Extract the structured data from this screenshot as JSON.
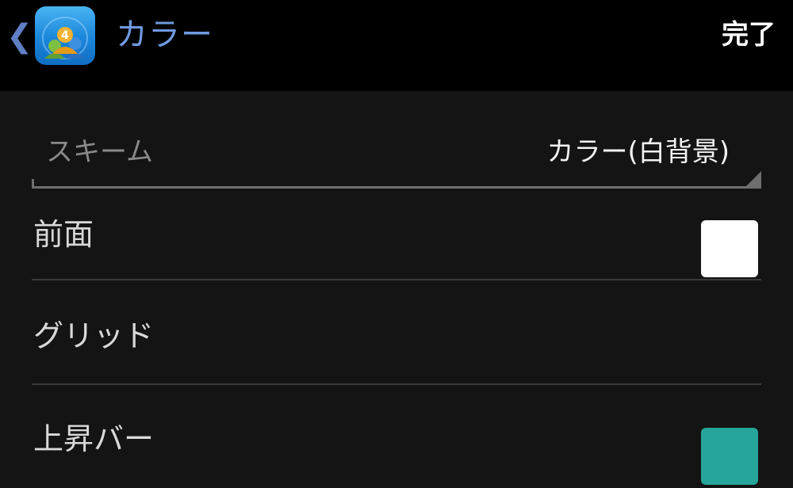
{
  "header": {
    "back_glyph": "❮",
    "app_icon": "metatrader-4-icon",
    "title": "カラー",
    "done_label": "完了",
    "title_color": "#6f9ae0"
  },
  "scheme": {
    "label": "スキーム",
    "value": "カラー(白背景)"
  },
  "rows": [
    {
      "label": "前面",
      "swatch_color": "#ffffff"
    },
    {
      "label": "グリッド"
    },
    {
      "label": "上昇バー",
      "swatch_color": "#26a69a"
    }
  ]
}
